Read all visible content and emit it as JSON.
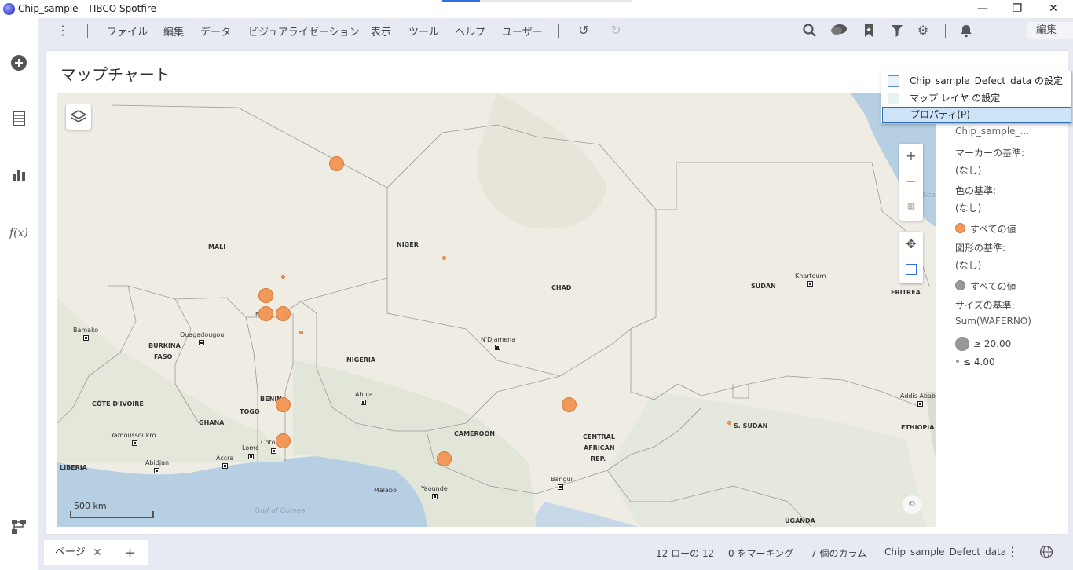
{
  "window": {
    "title": "Chip_sample - TIBCO Spotfire"
  },
  "menu": {
    "items": [
      "ファイル",
      "編集",
      "データ",
      "ビジュアライゼーション",
      "表示",
      "ツール",
      "ヘルプ",
      "ユーザー"
    ],
    "mode_select": "編集"
  },
  "panel": {
    "title": "マップチャート"
  },
  "map": {
    "countries": [
      "MALI",
      "NIGER",
      "CHAD",
      "SUDAN",
      "ERITREA",
      "BURKINA",
      "FASO",
      "NIGERIA",
      "BENIN",
      "TOGO",
      "GHANA",
      "CÔTE D'IVOIRE",
      "LIBERIA",
      "CAMEROON",
      "CENTRAL",
      "AFRICAN",
      "REP.",
      "S. SUDAN",
      "ETHIOPIA",
      "UGANDA"
    ],
    "cities": [
      "Bamako",
      "Ouagadougou",
      "N'Djamena",
      "Abuja",
      "Khartoum",
      "Addis Ababa",
      "Yamoussoukro",
      "Abidjan",
      "Accra",
      "Lomé",
      "Coton",
      "Malabo",
      "Yaounde",
      "Bangui"
    ],
    "water": [
      "Gulf of Guinea",
      "Sea"
    ],
    "marker_city_fragment": "N",
    "scale_label": "500 km"
  },
  "context_menu": {
    "items": [
      "Chip_sample_Defect_data の設定",
      "マップ レイヤ の設定",
      "プロパティ(P)"
    ]
  },
  "legend": {
    "layer_name": "Chip_sample_...",
    "marker_by_label": "マーカーの基準:",
    "marker_by_value": "(なし)",
    "color_by_label": "色の基準:",
    "color_by_value": "(なし)",
    "color_item": "すべての値",
    "shape_by_label": "図形の基準:",
    "shape_by_value": "(なし)",
    "shape_item": "すべての値",
    "size_by_label": "サイズの基準:",
    "size_by_value": "Sum(WAFERNO)",
    "size_max": "≥ 20.00",
    "size_min": "≤ 4.00",
    "marker_color": "#f0995a"
  },
  "status": {
    "page_tab": "ページ",
    "rows": "12 ローの 12",
    "marked": "0 をマーキング",
    "columns": "7 個のカラム",
    "table": "Chip_sample_Defect_data"
  }
}
